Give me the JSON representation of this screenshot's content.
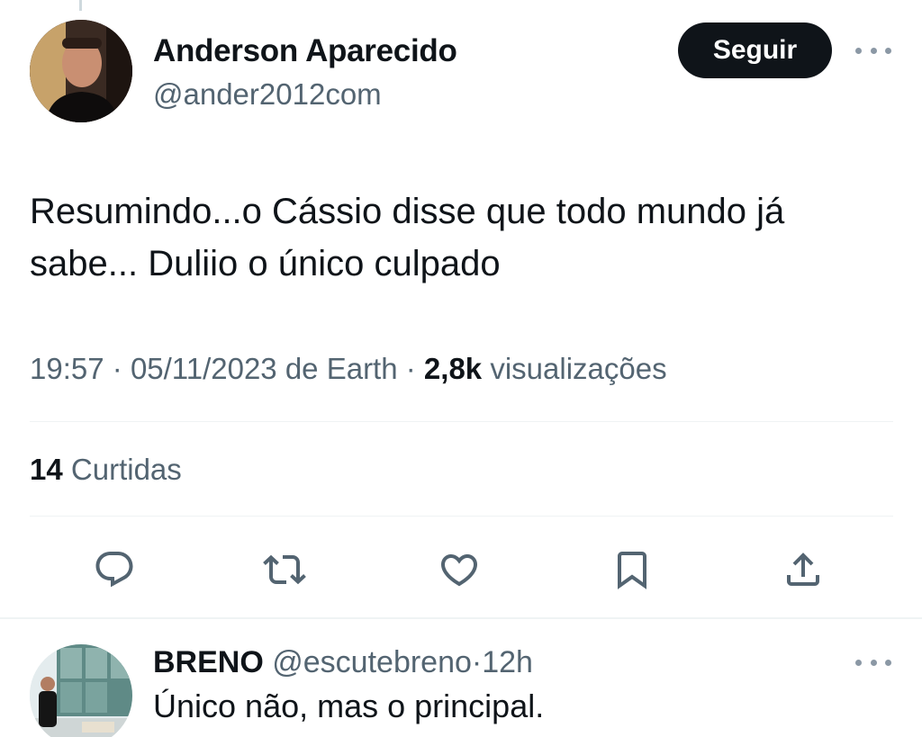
{
  "tweet": {
    "author": {
      "name": "Anderson Aparecido",
      "handle": "@ander2012com"
    },
    "follow_label": "Seguir",
    "more_icon": "more-horizontal-icon",
    "text_lines": [
      "Resumindo...o Cássio disse que todo mundo já",
      "sabe... Duliio o único culpado"
    ],
    "time": "19:57",
    "date": "05/11/2023",
    "source": "de Earth",
    "views_count": "2,8k",
    "views_label": "visualizações",
    "likes_count": "14",
    "likes_label": "Curtidas",
    "actions": [
      {
        "name": "reply",
        "icon": "reply-icon"
      },
      {
        "name": "retweet",
        "icon": "retweet-icon"
      },
      {
        "name": "like",
        "icon": "heart-icon"
      },
      {
        "name": "bookmark",
        "icon": "bookmark-icon"
      },
      {
        "name": "share",
        "icon": "share-icon"
      }
    ]
  },
  "reply": {
    "name": "BRENO",
    "handle": "@escutebreno",
    "time": "12h",
    "text": "Único não, mas o principal."
  },
  "colors": {
    "text": "#0f1419",
    "secondary": "#536471",
    "divider": "#eff3f4",
    "button_bg": "#0f1419"
  },
  "separator": "·"
}
